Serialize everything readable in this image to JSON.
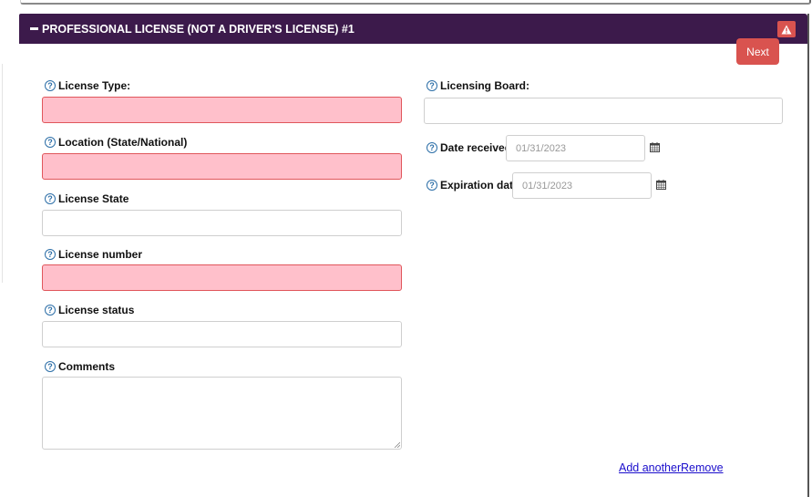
{
  "panel": {
    "title": "PROFESSIONAL LICENSE (NOT A DRIVER'S LICENSE) #1",
    "header_color": "#3c1a4b",
    "warning_icon": "warning-triangle-icon",
    "next_label": "Next"
  },
  "left_column": {
    "license_type": {
      "label": "License Type:",
      "value": "",
      "invalid": true
    },
    "location": {
      "label": "Location (State/National)",
      "value": "",
      "invalid": true
    },
    "license_state": {
      "label": "License State",
      "value": "",
      "invalid": false
    },
    "license_number": {
      "label": "License number",
      "value": "",
      "invalid": true
    },
    "license_status": {
      "label": "License status",
      "value": "",
      "invalid": false
    },
    "comments": {
      "label": "Comments",
      "value": ""
    }
  },
  "right_column": {
    "licensing_board": {
      "label": "Licensing Board:",
      "value": ""
    },
    "date_received": {
      "label": "Date received",
      "placeholder": "01/31/2023"
    },
    "expiration_date": {
      "label": "Expiration date",
      "placeholder": "01/31/2023"
    }
  },
  "footer": {
    "add_another": "Add another",
    "remove": "Remove"
  },
  "colors": {
    "invalid_bg": "#ffc0cb",
    "invalid_border": "#e0565b",
    "danger": "#d9534f",
    "help_icon": "#2d6fa8",
    "link": "#1a0dcc"
  }
}
